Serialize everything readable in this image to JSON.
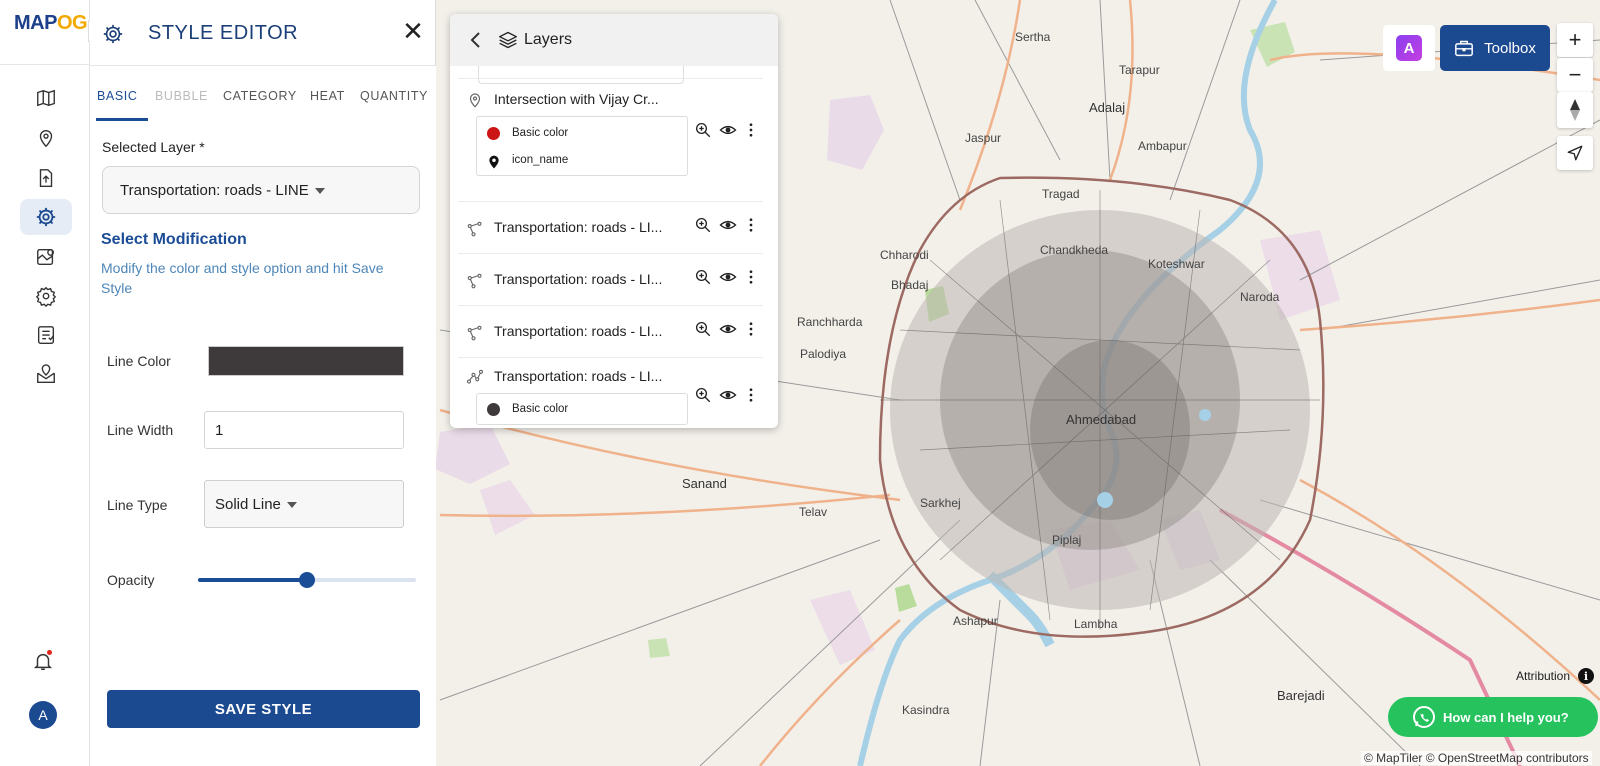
{
  "brand": {
    "logo_text_a": "MAP",
    "logo_text_b": "OG"
  },
  "rail": {
    "icons": [
      "map-icon",
      "location-pin-icon",
      "upload-icon",
      "gear-icon",
      "map-analysis-icon",
      "settings-icon",
      "report-icon",
      "map-marker-box-icon"
    ],
    "active_index": 3,
    "collapse_glyph": "›",
    "avatar_initial": "A"
  },
  "editor": {
    "title": "STYLE EDITOR",
    "close_glyph": "✕",
    "tabs": [
      {
        "label": "BASIC",
        "state": "active"
      },
      {
        "label": "BUBBLE",
        "state": "disabled"
      },
      {
        "label": "CATEGORY",
        "state": "normal"
      },
      {
        "label": "HEAT",
        "state": "normal"
      },
      {
        "label": "QUANTITY",
        "state": "normal"
      }
    ],
    "selected_layer_label": "Selected Layer *",
    "selected_layer_value": "Transportation: roads - LINE",
    "modification_title": "Select Modification",
    "modification_desc": "Modify the color and style option and hit Save Style",
    "line_color_label": "Line Color",
    "line_color_value": "#3e3a3b",
    "line_width_label": "Line Width",
    "line_width_value": "1",
    "line_type_label": "Line Type",
    "line_type_value": "Solid Line",
    "opacity_label": "Opacity",
    "opacity_value": 0.5,
    "save_label": "SAVE STYLE"
  },
  "layers": {
    "title": "Layers",
    "items": [
      {
        "name": "Intersection with Vijay Cr...",
        "icon": "location-pin-icon",
        "legend": [
          {
            "label": "Basic color",
            "color": "#cc1616",
            "kind": "dot"
          },
          {
            "label": "icon_name",
            "color": "#111111",
            "kind": "pin"
          }
        ]
      },
      {
        "name": "Transportation: roads - LI...",
        "icon": "line-nodes-icon",
        "legend": []
      },
      {
        "name": "Transportation: roads - LI...",
        "icon": "line-nodes-icon",
        "legend": []
      },
      {
        "name": "Transportation: roads - LI...",
        "icon": "line-nodes-icon",
        "legend": []
      },
      {
        "name": "Transportation: roads - LI...",
        "icon": "polyline-icon",
        "legend": [
          {
            "label": "Basic color",
            "color": "#3e3a3b",
            "kind": "dot"
          }
        ]
      }
    ]
  },
  "toolbar": {
    "toolbox_label": "Toolbox",
    "ai_label": "A",
    "zoom_in": "+",
    "zoom_out": "−"
  },
  "map": {
    "places": [
      {
        "name": "Sertha"
      },
      {
        "name": "Tarapur"
      },
      {
        "name": "Adalaj"
      },
      {
        "name": "Jaspur"
      },
      {
        "name": "Ambapur"
      },
      {
        "name": "Tragad"
      },
      {
        "name": "Chandkheda"
      },
      {
        "name": "Koteshwar"
      },
      {
        "name": "Chharodi"
      },
      {
        "name": "Bhadaj"
      },
      {
        "name": "Naroda"
      },
      {
        "name": "Ranchharda"
      },
      {
        "name": "Palodiya"
      },
      {
        "name": "Ahmedabad"
      },
      {
        "name": "Sanand"
      },
      {
        "name": "Telav"
      },
      {
        "name": "Sarkhej"
      },
      {
        "name": "Piplaj"
      },
      {
        "name": "Ashapur"
      },
      {
        "name": "Lambha"
      },
      {
        "name": "Kasindra"
      },
      {
        "name": "Barejadi"
      }
    ],
    "attribution_label": "Attribution",
    "copyright": "© MapTiler © OpenStreetMap contributors"
  },
  "help": {
    "label": "How can I help you?"
  }
}
